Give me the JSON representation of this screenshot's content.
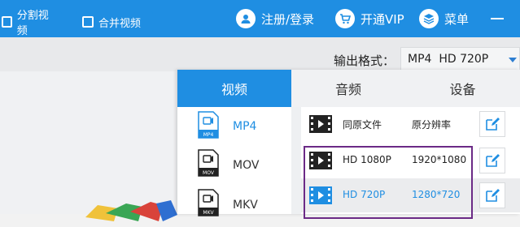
{
  "topbar": {
    "register_login": "注册/登录",
    "vip": "开通VIP",
    "menu": "菜单",
    "register_icon": "user-icon",
    "vip_icon": "cart-icon",
    "menu_icon": "layers-icon",
    "minimize_icon": "minimize-icon"
  },
  "toolbar": {
    "split_video": "分割视频",
    "merge_video": "合并视频",
    "output_format_label": "输出格式：",
    "output_format_value": "MP4  HD 720P"
  },
  "tabs": [
    {
      "label": "视频",
      "active": true
    },
    {
      "label": "音频",
      "active": false
    },
    {
      "label": "设备",
      "active": false
    }
  ],
  "formats": [
    {
      "label": "MP4",
      "badge": "MP4",
      "selected": true
    },
    {
      "label": "MOV",
      "badge": "MOV",
      "selected": false
    },
    {
      "label": "MKV",
      "badge": "MKV",
      "selected": false
    }
  ],
  "resolutions": [
    {
      "name": "同原文件",
      "value": "原分辨率",
      "active": false,
      "highlight": false
    },
    {
      "name": "HD 1080P",
      "value": "1920*1080",
      "active": false,
      "highlight": false
    },
    {
      "name": "HD 720P",
      "value": "1280*720",
      "active": true,
      "highlight": true
    }
  ],
  "colors": {
    "accent": "#1f8ee2",
    "annotation": "#6b2a86"
  }
}
